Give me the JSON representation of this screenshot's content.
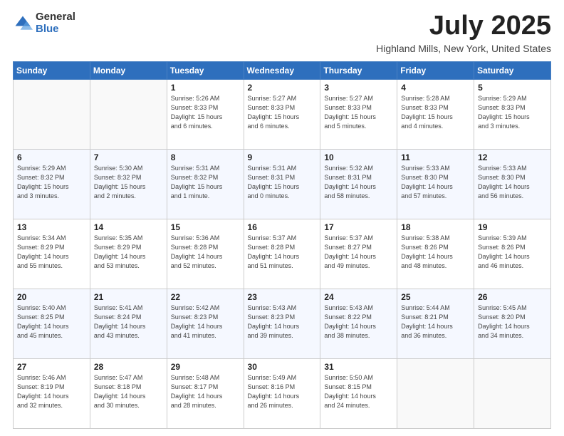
{
  "logo": {
    "general": "General",
    "blue": "Blue"
  },
  "title": {
    "month_year": "July 2025",
    "location": "Highland Mills, New York, United States"
  },
  "days_of_week": [
    "Sunday",
    "Monday",
    "Tuesday",
    "Wednesday",
    "Thursday",
    "Friday",
    "Saturday"
  ],
  "weeks": [
    [
      {
        "day": "",
        "info": ""
      },
      {
        "day": "",
        "info": ""
      },
      {
        "day": "1",
        "info": "Sunrise: 5:26 AM\nSunset: 8:33 PM\nDaylight: 15 hours\nand 6 minutes."
      },
      {
        "day": "2",
        "info": "Sunrise: 5:27 AM\nSunset: 8:33 PM\nDaylight: 15 hours\nand 6 minutes."
      },
      {
        "day": "3",
        "info": "Sunrise: 5:27 AM\nSunset: 8:33 PM\nDaylight: 15 hours\nand 5 minutes."
      },
      {
        "day": "4",
        "info": "Sunrise: 5:28 AM\nSunset: 8:33 PM\nDaylight: 15 hours\nand 4 minutes."
      },
      {
        "day": "5",
        "info": "Sunrise: 5:29 AM\nSunset: 8:33 PM\nDaylight: 15 hours\nand 3 minutes."
      }
    ],
    [
      {
        "day": "6",
        "info": "Sunrise: 5:29 AM\nSunset: 8:32 PM\nDaylight: 15 hours\nand 3 minutes."
      },
      {
        "day": "7",
        "info": "Sunrise: 5:30 AM\nSunset: 8:32 PM\nDaylight: 15 hours\nand 2 minutes."
      },
      {
        "day": "8",
        "info": "Sunrise: 5:31 AM\nSunset: 8:32 PM\nDaylight: 15 hours\nand 1 minute."
      },
      {
        "day": "9",
        "info": "Sunrise: 5:31 AM\nSunset: 8:31 PM\nDaylight: 15 hours\nand 0 minutes."
      },
      {
        "day": "10",
        "info": "Sunrise: 5:32 AM\nSunset: 8:31 PM\nDaylight: 14 hours\nand 58 minutes."
      },
      {
        "day": "11",
        "info": "Sunrise: 5:33 AM\nSunset: 8:30 PM\nDaylight: 14 hours\nand 57 minutes."
      },
      {
        "day": "12",
        "info": "Sunrise: 5:33 AM\nSunset: 8:30 PM\nDaylight: 14 hours\nand 56 minutes."
      }
    ],
    [
      {
        "day": "13",
        "info": "Sunrise: 5:34 AM\nSunset: 8:29 PM\nDaylight: 14 hours\nand 55 minutes."
      },
      {
        "day": "14",
        "info": "Sunrise: 5:35 AM\nSunset: 8:29 PM\nDaylight: 14 hours\nand 53 minutes."
      },
      {
        "day": "15",
        "info": "Sunrise: 5:36 AM\nSunset: 8:28 PM\nDaylight: 14 hours\nand 52 minutes."
      },
      {
        "day": "16",
        "info": "Sunrise: 5:37 AM\nSunset: 8:28 PM\nDaylight: 14 hours\nand 51 minutes."
      },
      {
        "day": "17",
        "info": "Sunrise: 5:37 AM\nSunset: 8:27 PM\nDaylight: 14 hours\nand 49 minutes."
      },
      {
        "day": "18",
        "info": "Sunrise: 5:38 AM\nSunset: 8:26 PM\nDaylight: 14 hours\nand 48 minutes."
      },
      {
        "day": "19",
        "info": "Sunrise: 5:39 AM\nSunset: 8:26 PM\nDaylight: 14 hours\nand 46 minutes."
      }
    ],
    [
      {
        "day": "20",
        "info": "Sunrise: 5:40 AM\nSunset: 8:25 PM\nDaylight: 14 hours\nand 45 minutes."
      },
      {
        "day": "21",
        "info": "Sunrise: 5:41 AM\nSunset: 8:24 PM\nDaylight: 14 hours\nand 43 minutes."
      },
      {
        "day": "22",
        "info": "Sunrise: 5:42 AM\nSunset: 8:23 PM\nDaylight: 14 hours\nand 41 minutes."
      },
      {
        "day": "23",
        "info": "Sunrise: 5:43 AM\nSunset: 8:23 PM\nDaylight: 14 hours\nand 39 minutes."
      },
      {
        "day": "24",
        "info": "Sunrise: 5:43 AM\nSunset: 8:22 PM\nDaylight: 14 hours\nand 38 minutes."
      },
      {
        "day": "25",
        "info": "Sunrise: 5:44 AM\nSunset: 8:21 PM\nDaylight: 14 hours\nand 36 minutes."
      },
      {
        "day": "26",
        "info": "Sunrise: 5:45 AM\nSunset: 8:20 PM\nDaylight: 14 hours\nand 34 minutes."
      }
    ],
    [
      {
        "day": "27",
        "info": "Sunrise: 5:46 AM\nSunset: 8:19 PM\nDaylight: 14 hours\nand 32 minutes."
      },
      {
        "day": "28",
        "info": "Sunrise: 5:47 AM\nSunset: 8:18 PM\nDaylight: 14 hours\nand 30 minutes."
      },
      {
        "day": "29",
        "info": "Sunrise: 5:48 AM\nSunset: 8:17 PM\nDaylight: 14 hours\nand 28 minutes."
      },
      {
        "day": "30",
        "info": "Sunrise: 5:49 AM\nSunset: 8:16 PM\nDaylight: 14 hours\nand 26 minutes."
      },
      {
        "day": "31",
        "info": "Sunrise: 5:50 AM\nSunset: 8:15 PM\nDaylight: 14 hours\nand 24 minutes."
      },
      {
        "day": "",
        "info": ""
      },
      {
        "day": "",
        "info": ""
      }
    ]
  ]
}
